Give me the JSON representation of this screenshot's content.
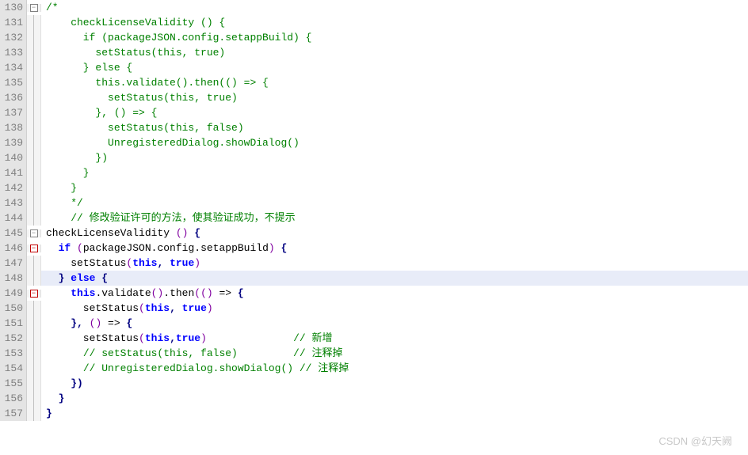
{
  "watermark": "CSDN @幻天阙",
  "folds": {
    "130": "minus",
    "145": "minus",
    "146": "minus-red",
    "149": "minus-red"
  },
  "highlight_line": 148,
  "lines": [
    {
      "n": 130,
      "fold": "minus",
      "tokens": [
        {
          "t": "/*",
          "c": "comment"
        }
      ]
    },
    {
      "n": 131,
      "tokens": [
        {
          "t": "    checkLicenseValidity () {",
          "c": "comment"
        }
      ]
    },
    {
      "n": 132,
      "tokens": [
        {
          "t": "      if (packageJSON.config.setappBuild) {",
          "c": "comment"
        }
      ]
    },
    {
      "n": 133,
      "tokens": [
        {
          "t": "        setStatus(this, true)",
          "c": "comment"
        }
      ]
    },
    {
      "n": 134,
      "tokens": [
        {
          "t": "      } else {",
          "c": "comment"
        }
      ]
    },
    {
      "n": 135,
      "tokens": [
        {
          "t": "        this.validate().then(() => {",
          "c": "comment"
        }
      ]
    },
    {
      "n": 136,
      "tokens": [
        {
          "t": "          setStatus(this, true)",
          "c": "comment"
        }
      ]
    },
    {
      "n": 137,
      "tokens": [
        {
          "t": "        }, () => {",
          "c": "comment"
        }
      ]
    },
    {
      "n": 138,
      "tokens": [
        {
          "t": "          setStatus(this, false)",
          "c": "comment"
        }
      ]
    },
    {
      "n": 139,
      "tokens": [
        {
          "t": "          UnregisteredDialog.showDialog()",
          "c": "comment"
        }
      ]
    },
    {
      "n": 140,
      "tokens": [
        {
          "t": "        })",
          "c": "comment"
        }
      ]
    },
    {
      "n": 141,
      "tokens": [
        {
          "t": "      }",
          "c": "comment"
        }
      ]
    },
    {
      "n": 142,
      "tokens": [
        {
          "t": "    }",
          "c": "comment"
        }
      ]
    },
    {
      "n": 143,
      "tokens": [
        {
          "t": "    */",
          "c": "comment"
        }
      ]
    },
    {
      "n": 144,
      "tokens": [
        {
          "t": "    // 修改验证许可的方法，使其验证成功，不提示",
          "c": "comment"
        }
      ]
    },
    {
      "n": 145,
      "fold": "minus",
      "tokens": [
        {
          "t": "checkLicenseValidity ",
          "c": "txt"
        },
        {
          "t": "()",
          "c": "paren"
        },
        {
          "t": " ",
          "c": "txt"
        },
        {
          "t": "{",
          "c": "punct"
        }
      ]
    },
    {
      "n": 146,
      "fold": "minus-red",
      "tokens": [
        {
          "t": "  ",
          "c": "txt"
        },
        {
          "t": "if",
          "c": "key"
        },
        {
          "t": " ",
          "c": "txt"
        },
        {
          "t": "(",
          "c": "paren"
        },
        {
          "t": "packageJSON.config.setappBuild",
          "c": "txt"
        },
        {
          "t": ")",
          "c": "paren"
        },
        {
          "t": " ",
          "c": "txt"
        },
        {
          "t": "{",
          "c": "punct"
        }
      ]
    },
    {
      "n": 147,
      "tokens": [
        {
          "t": "    setStatus",
          "c": "txt"
        },
        {
          "t": "(",
          "c": "paren"
        },
        {
          "t": "this",
          "c": "key"
        },
        {
          "t": ", ",
          "c": "punct"
        },
        {
          "t": "true",
          "c": "key"
        },
        {
          "t": ")",
          "c": "paren"
        }
      ]
    },
    {
      "n": 148,
      "hl": true,
      "tokens": [
        {
          "t": "  ",
          "c": "txt"
        },
        {
          "t": "}",
          "c": "punct"
        },
        {
          "t": " ",
          "c": "txt"
        },
        {
          "t": "else",
          "c": "key"
        },
        {
          "t": " ",
          "c": "txt"
        },
        {
          "t": "{",
          "c": "punct"
        }
      ]
    },
    {
      "n": 149,
      "fold": "minus-red",
      "tokens": [
        {
          "t": "    ",
          "c": "txt"
        },
        {
          "t": "this",
          "c": "key"
        },
        {
          "t": ".validate",
          "c": "txt"
        },
        {
          "t": "()",
          "c": "paren"
        },
        {
          "t": ".then",
          "c": "txt"
        },
        {
          "t": "((",
          "c": "paren"
        },
        {
          "t": ")",
          "c": "paren"
        },
        {
          "t": " => ",
          "c": "txt"
        },
        {
          "t": "{",
          "c": "punct"
        }
      ]
    },
    {
      "n": 150,
      "tokens": [
        {
          "t": "      setStatus",
          "c": "txt"
        },
        {
          "t": "(",
          "c": "paren"
        },
        {
          "t": "this",
          "c": "key"
        },
        {
          "t": ", ",
          "c": "punct"
        },
        {
          "t": "true",
          "c": "key"
        },
        {
          "t": ")",
          "c": "paren"
        }
      ]
    },
    {
      "n": 151,
      "tokens": [
        {
          "t": "    ",
          "c": "txt"
        },
        {
          "t": "}",
          "c": "punct"
        },
        {
          "t": ", ",
          "c": "punct"
        },
        {
          "t": "()",
          "c": "paren"
        },
        {
          "t": " => ",
          "c": "txt"
        },
        {
          "t": "{",
          "c": "punct"
        }
      ]
    },
    {
      "n": 152,
      "tokens": [
        {
          "t": "      setStatus",
          "c": "txt"
        },
        {
          "t": "(",
          "c": "paren"
        },
        {
          "t": "this",
          "c": "key"
        },
        {
          "t": ",",
          "c": "punct"
        },
        {
          "t": "true",
          "c": "key"
        },
        {
          "t": ")",
          "c": "paren"
        },
        {
          "t": "              ",
          "c": "txt"
        },
        {
          "t": "// 新增",
          "c": "comment"
        }
      ]
    },
    {
      "n": 153,
      "tokens": [
        {
          "t": "      ",
          "c": "txt"
        },
        {
          "t": "// setStatus(this, false)         // 注释掉",
          "c": "comment"
        }
      ]
    },
    {
      "n": 154,
      "tokens": [
        {
          "t": "      ",
          "c": "txt"
        },
        {
          "t": "// UnregisteredDialog.showDialog() // 注释掉",
          "c": "comment"
        }
      ]
    },
    {
      "n": 155,
      "tokens": [
        {
          "t": "    ",
          "c": "txt"
        },
        {
          "t": "})",
          "c": "punct"
        }
      ]
    },
    {
      "n": 156,
      "tokens": [
        {
          "t": "  ",
          "c": "txt"
        },
        {
          "t": "}",
          "c": "punct"
        }
      ]
    },
    {
      "n": 157,
      "tokens": [
        {
          "t": "}",
          "c": "punct"
        }
      ]
    }
  ]
}
